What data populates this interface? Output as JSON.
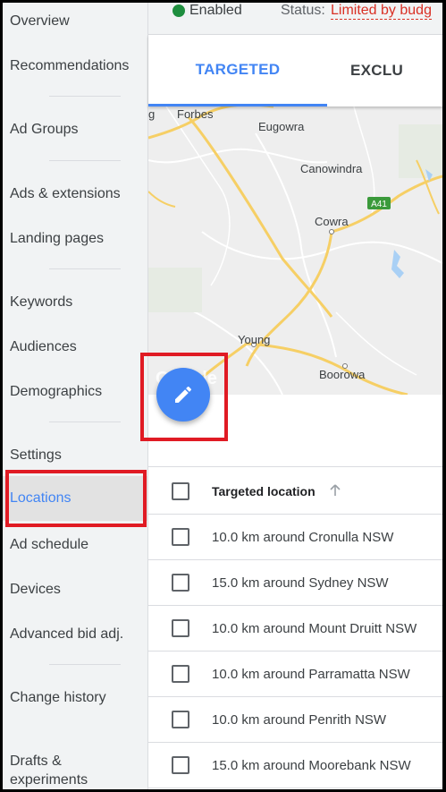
{
  "sidebar": {
    "items": [
      {
        "label": "Overview"
      },
      {
        "label": "Recommendations"
      },
      {
        "label": "Ad Groups"
      },
      {
        "label": "Ads & extensions"
      },
      {
        "label": "Landing pages"
      },
      {
        "label": "Keywords"
      },
      {
        "label": "Audiences"
      },
      {
        "label": "Demographics"
      },
      {
        "label": "Settings"
      },
      {
        "label": "Locations"
      },
      {
        "label": "Ad schedule"
      },
      {
        "label": "Devices"
      },
      {
        "label": "Advanced bid adj."
      },
      {
        "label": "Change history"
      },
      {
        "label": "Drafts &\nexperiments"
      }
    ],
    "active": "Locations"
  },
  "status_bar": {
    "enabled": "Enabled",
    "status_label": "Status:",
    "status_value": "Limited by budg"
  },
  "tabs": [
    {
      "label": "TARGETED",
      "active": true
    },
    {
      "label": "EXCLU",
      "active": false
    }
  ],
  "map": {
    "places": [
      "Forbes",
      "Eugowra",
      "Canowindra",
      "Cowra",
      "Young",
      "Boorowa",
      "g"
    ],
    "road_shield": "A41",
    "watermark": "Google"
  },
  "table": {
    "header": "Targeted location",
    "rows": [
      "10.0 km around Cronulla NSW",
      "15.0 km around Sydney NSW",
      "10.0 km around Mount Druitt NSW",
      "10.0 km around Parramatta NSW",
      "10.0 km around Penrith NSW",
      "15.0 km around Moorebank NSW"
    ]
  },
  "colors": {
    "accent": "#4285f4",
    "enabled": "#1e8e3e",
    "status_warning": "#d93025",
    "highlight": "#e01b24"
  }
}
